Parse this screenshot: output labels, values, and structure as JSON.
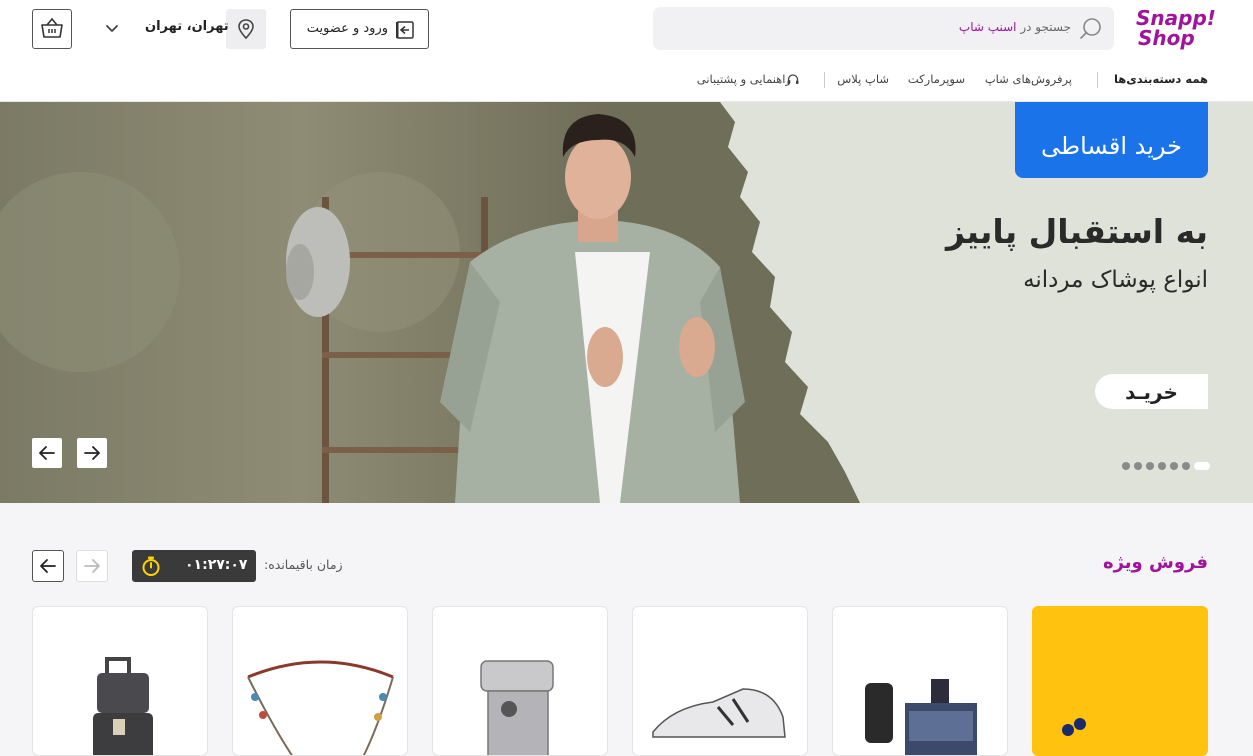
{
  "header": {
    "logo": {
      "line1": "Snapp!",
      "line2": "Shop"
    },
    "search": {
      "placeholder_prefix": "جستجو در",
      "placeholder_brand": "اسنپ شاپ"
    },
    "login_label": "ورود و عضویت",
    "location": "تهران، تهران"
  },
  "nav": {
    "all_categories": "همه دسته‌بندی‌ها",
    "bestsellers": "پرفروش‌های شاپ",
    "supermarket": "سوپرمارکت",
    "shop_plus": "شاپ پلاس",
    "help": "راهنمایی و پشتیبانی"
  },
  "hero": {
    "badge": "خرید اقساطی",
    "title": "به استقبال پاییز",
    "subtitle": "انواع پوشاک مردانه",
    "button": "خریـد",
    "slide_count": 7,
    "active_slide": 0
  },
  "special_sale": {
    "title": "فروش ویژه",
    "timer_label": "زمان باقیمانده:",
    "timer_value": "۰۱:۲۷:۰۷"
  },
  "products": [
    {
      "icon": "promo-banner"
    },
    {
      "icon": "perfume-icon"
    },
    {
      "icon": "sneaker-icon"
    },
    {
      "icon": "espresso-machine-icon"
    },
    {
      "icon": "bracelet-icon"
    },
    {
      "icon": "suitcase-icon"
    }
  ],
  "colors": {
    "brand": "#a0149b",
    "installment": "#1a73e8",
    "promo": "#ffc20e"
  }
}
